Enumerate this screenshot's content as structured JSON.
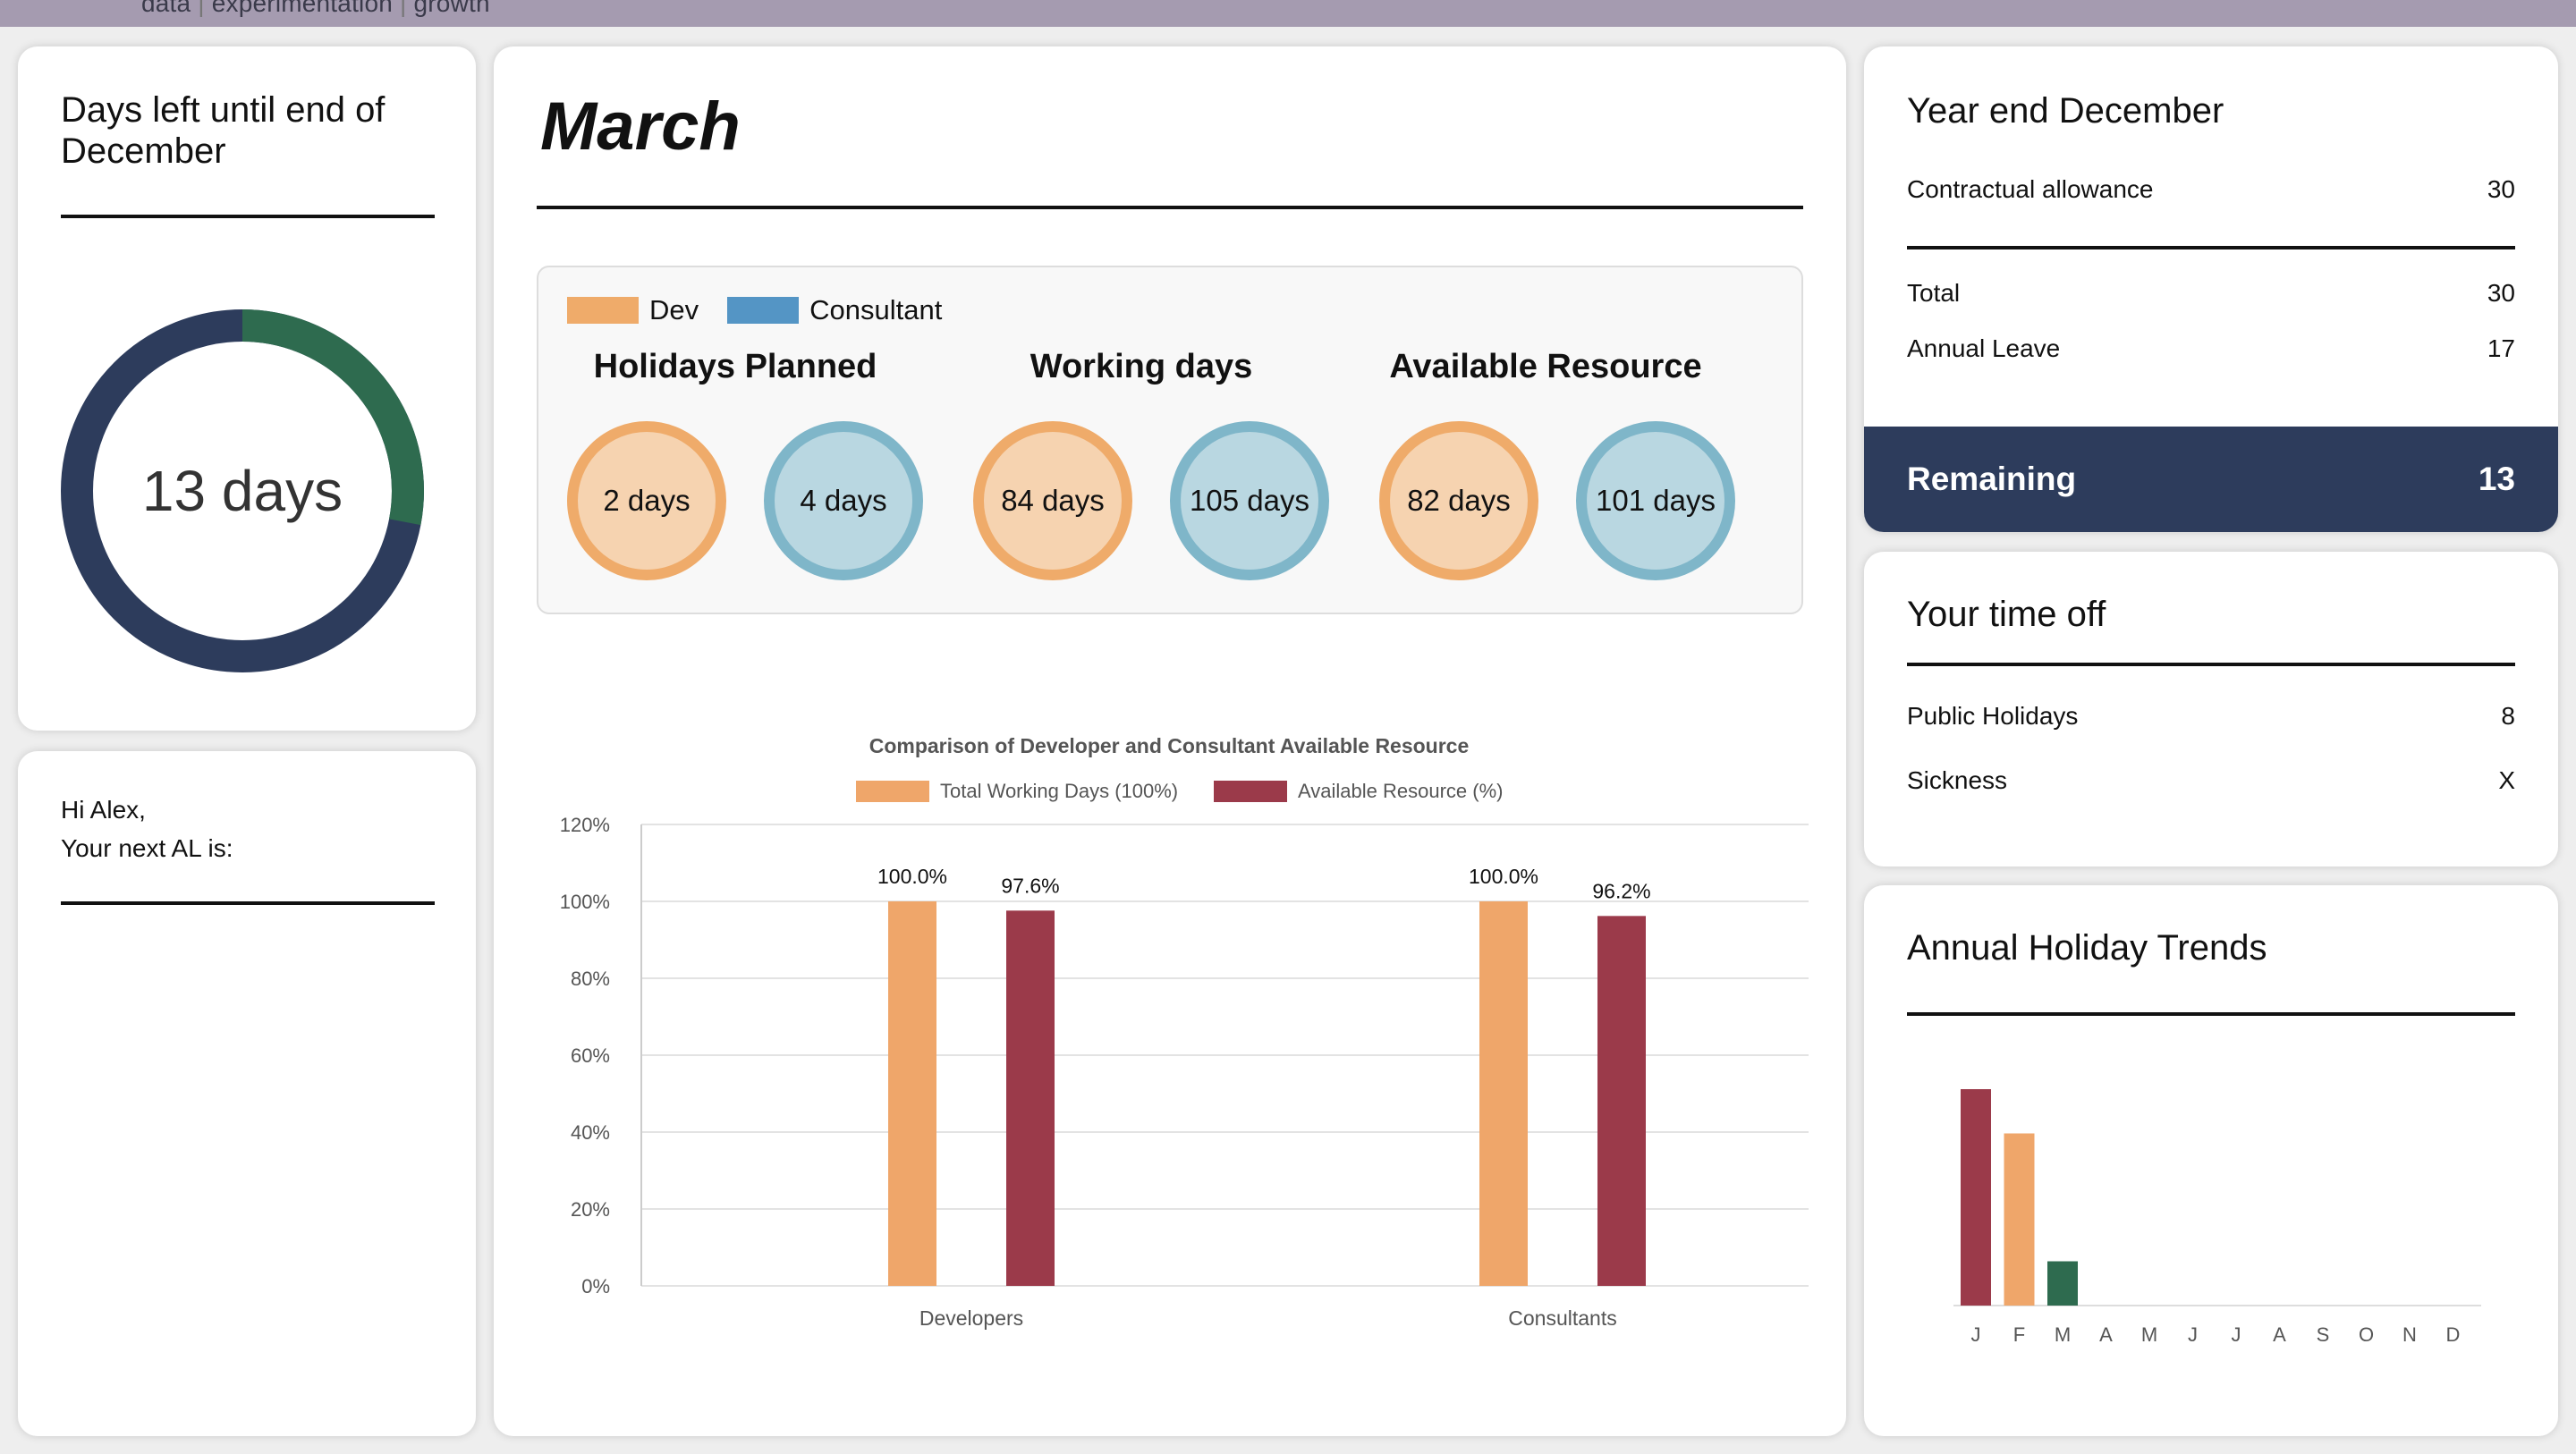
{
  "topbar": {
    "parts": [
      "data",
      "experimentation",
      "growth"
    ],
    "separator": "|"
  },
  "countdown": {
    "title": "Days left until end of December",
    "label": "13 days",
    "days_left": 13,
    "progress_fraction": 0.28,
    "ring_color": "#2d3c5c",
    "progress_color": "#2e6b4f"
  },
  "greeting": {
    "line1": "Hi Alex,",
    "line2": "Your next AL is:"
  },
  "month": {
    "title": "March"
  },
  "legend": {
    "dev_label": "Dev",
    "dev_color": "#efab6a",
    "consultant_label": "Consultant",
    "consultant_color": "#5495c5"
  },
  "summary": {
    "holidays": {
      "title": "Holidays Planned",
      "dev": "2 days",
      "consultant": "4 days"
    },
    "working": {
      "title": "Working days",
      "dev": "84 days",
      "consultant": "105 days"
    },
    "available": {
      "title": "Available Resource",
      "dev": "82 days",
      "consultant": "101 days"
    }
  },
  "chart_data": [
    {
      "type": "bar",
      "title": "Comparison of Developer and Consultant Available Resource",
      "categories": [
        "Developers",
        "Consultants"
      ],
      "series": [
        {
          "name": "Total Working Days (100%)",
          "values": [
            100.0,
            100.0
          ],
          "labels": [
            "100.0%",
            "100.0%"
          ],
          "color": "#efa66a"
        },
        {
          "name": "Available Resource (%)",
          "values": [
            97.6,
            96.2
          ],
          "labels": [
            "97.6%",
            "96.2%"
          ],
          "color": "#9b3a4a"
        }
      ],
      "ylim": [
        0,
        120
      ],
      "yticks": [
        "0%",
        "20%",
        "40%",
        "60%",
        "80%",
        "100%",
        "120%"
      ],
      "grid": true,
      "legend": "top"
    },
    {
      "type": "bar",
      "title": "",
      "categories": [
        "J",
        "F",
        "M",
        "A",
        "M",
        "J",
        "J",
        "A",
        "S",
        "O",
        "N",
        "D"
      ],
      "values": [
        44,
        35,
        9,
        0,
        0,
        0,
        0,
        0,
        0,
        0,
        0,
        0
      ],
      "colors": [
        "#9b3a4a",
        "#efa66a",
        "#2e6b4f"
      ],
      "grid": false
    }
  ],
  "year_end": {
    "title": "Year end December",
    "contractual_label": "Contractual allowance",
    "contractual_value": "30",
    "total_label": "Total",
    "total_value": "30",
    "annual_label": "Annual Leave",
    "annual_value": "17",
    "remaining_label": "Remaining",
    "remaining_value": "13"
  },
  "time_off": {
    "title": "Your time off",
    "public_label": "Public Holidays",
    "public_value": "8",
    "sickness_label": "Sickness",
    "sickness_value": "X"
  },
  "trends": {
    "title": "Annual Holiday Trends"
  }
}
